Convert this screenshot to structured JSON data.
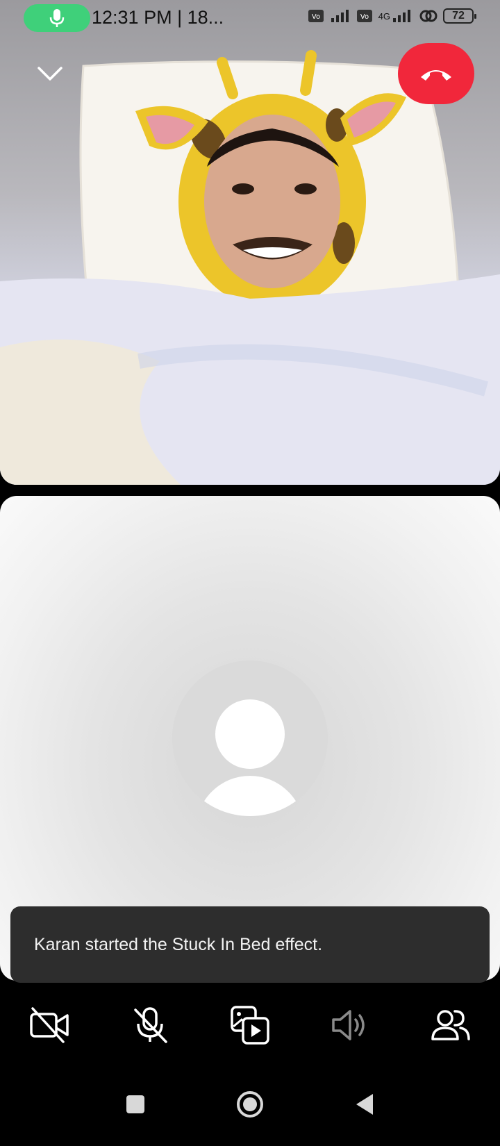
{
  "status_bar": {
    "time": "12:31 PM | 18...",
    "network_label": "4G",
    "battery": "72",
    "mic_icon": "microphone-icon"
  },
  "call": {
    "collapse_icon": "chevron-down-icon",
    "end_call_icon": "phone-hangup-icon",
    "end_call_color": "#f1273b"
  },
  "toast": {
    "message": "Karan started the Stuck In Bed effect."
  },
  "controls": [
    {
      "name": "camera-off",
      "icon": "video-off-icon"
    },
    {
      "name": "mute",
      "icon": "mic-off-icon"
    },
    {
      "name": "effects",
      "icon": "media-play-icon"
    },
    {
      "name": "speaker",
      "icon": "speaker-icon"
    },
    {
      "name": "participants",
      "icon": "people-icon"
    }
  ],
  "nav": [
    "recents-square-icon",
    "home-circle-icon",
    "back-triangle-icon"
  ]
}
